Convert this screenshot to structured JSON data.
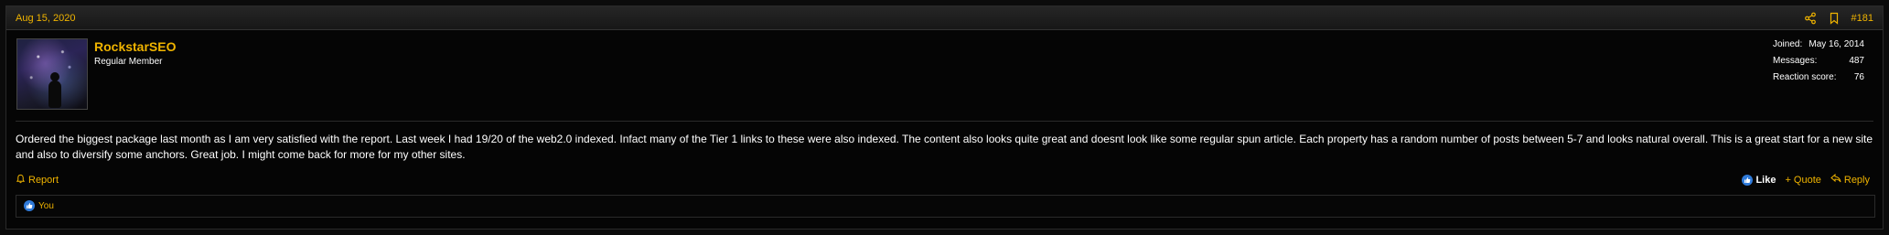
{
  "post": {
    "date": "Aug 15, 2020",
    "number": "#181",
    "share_icon": "share-icon",
    "bookmark_icon": "bookmark-icon"
  },
  "user": {
    "name": "RockstarSEO",
    "title": "Regular Member",
    "avatar_icon": "avatar-image",
    "extras": {
      "joined_label": "Joined:",
      "joined_value": "May 16, 2014",
      "messages_label": "Messages:",
      "messages_value": "487",
      "reaction_label": "Reaction score:",
      "reaction_value": "76"
    }
  },
  "message": {
    "text": "Ordered the biggest package last month as I am very satisfied with the report. Last week I had 19/20 of the web2.0 indexed. Infact many of the Tier 1 links to these were also indexed. The content also looks quite great and doesnt look like some regular spun article. Each property has a random number of posts between 5-7 and looks natural overall. This is a great start for a new site and also to diversify some anchors. Great job. I might come back for more for my other sites."
  },
  "footer": {
    "report_label": "Report",
    "like_label": "Like",
    "quote_label": "Quote",
    "reply_label": "Reply"
  },
  "reactions": {
    "by": "You"
  },
  "colors": {
    "accent": "#f0b400",
    "like_blue": "#2f7ad9"
  }
}
